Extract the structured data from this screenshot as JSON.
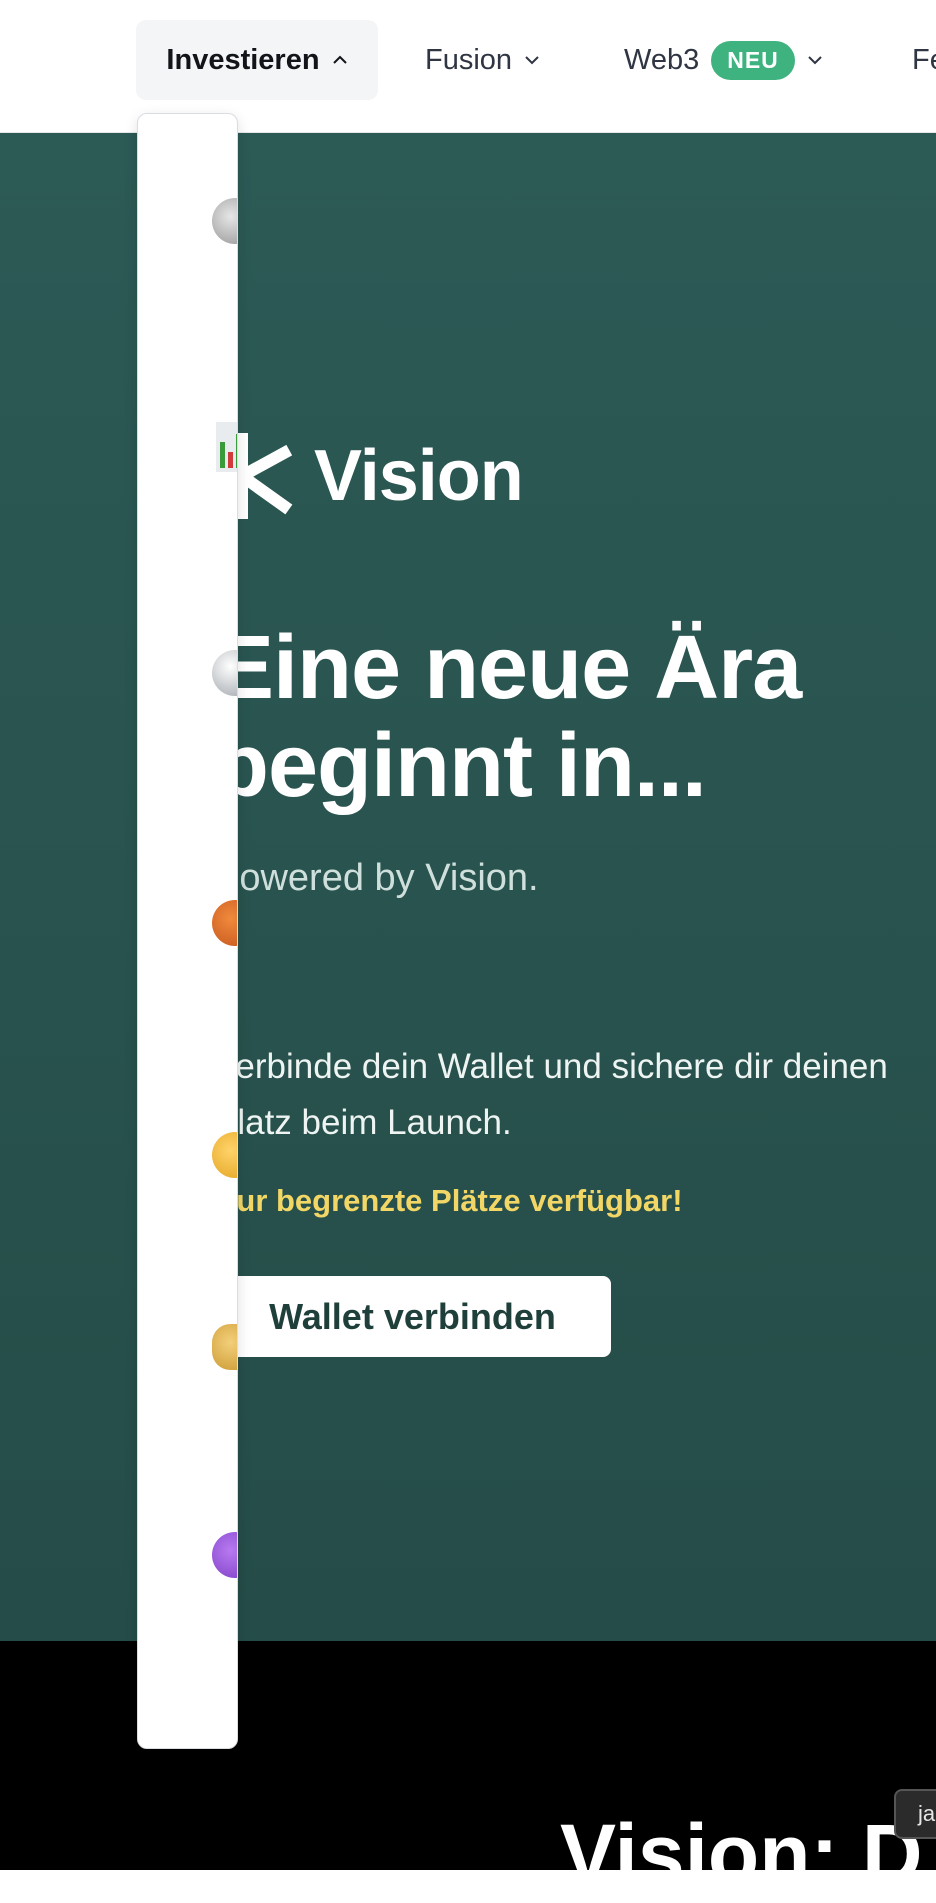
{
  "nav": {
    "items": [
      {
        "label": "Investieren",
        "active": true
      },
      {
        "label": "Fusion"
      },
      {
        "label": "Web3",
        "badge": "NEU"
      },
      {
        "label": "Fe"
      }
    ]
  },
  "dropdown": {
    "icons": [
      "coin-icon",
      "chart-icon",
      "globe-icon",
      "basketball-icon",
      "medal-icon",
      "money-bag-icon",
      "purple-heart-icon"
    ]
  },
  "hero": {
    "logo_text": "Vision",
    "title_line1": "Eine neue Ära",
    "title_line2": "beginnt in...",
    "subtitle": "Powered by Vision.",
    "cta_text": "Verbinde dein Wallet und sichere dir deinen Platz beim Launch.",
    "limit_text": "Nur begrenzte Plätze verfügbar!",
    "wallet_button": "Wallet verbinden",
    "background": "#2c5a55",
    "accent_yellow": "#f2d766"
  },
  "footer_section": {
    "title": "Vision: D",
    "lang_button": "ja"
  },
  "colors": {
    "badge_green": "#3fb37f",
    "dark_bg": "#000000"
  }
}
